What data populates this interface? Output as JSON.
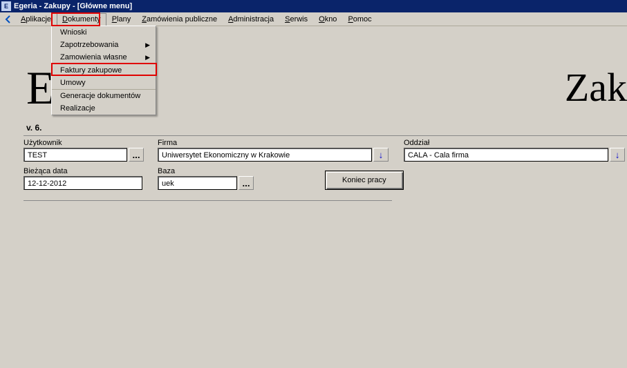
{
  "window": {
    "title": "Egeria - Zakupy - [Główne menu]"
  },
  "menubar": {
    "items": [
      {
        "label": "Aplikacje",
        "u": "A"
      },
      {
        "label": "Dokumenty",
        "u": "D"
      },
      {
        "label": "Plany",
        "u": "P"
      },
      {
        "label": "Zamówienia publiczne",
        "u": "Z"
      },
      {
        "label": "Administracja",
        "u": "A"
      },
      {
        "label": "Serwis",
        "u": "S"
      },
      {
        "label": "Okno",
        "u": "O"
      },
      {
        "label": "Pomoc",
        "u": "P"
      }
    ]
  },
  "dropdown": {
    "items": [
      {
        "label": "Wnioski",
        "submenu": false,
        "u": "W"
      },
      {
        "label": "Zapotrzebowania",
        "submenu": true,
        "u": "Z"
      },
      {
        "label": "Zamowienia własne",
        "submenu": true,
        "u": "a",
        "sep": true
      },
      {
        "label": "Faktury zakupowe",
        "submenu": false,
        "u": "F"
      },
      {
        "label": "Umowy",
        "submenu": false,
        "u": "U",
        "sep": true
      },
      {
        "label": "Generacje dokumentów",
        "submenu": false,
        "u": "G"
      },
      {
        "label": "Realizacje",
        "submenu": false,
        "u": "R"
      }
    ]
  },
  "page": {
    "title_left_fragment": "E",
    "title_right_fragment": "Zak",
    "version": "v. 6."
  },
  "form": {
    "user_label": "Użytkownik",
    "user_value": "TEST",
    "firm_label": "Firma",
    "firm_value": "Uniwersytet Ekonomiczny w Krakowie",
    "branch_label": "Oddział",
    "branch_value": "CALA - Cala firma",
    "date_label": "Bieżąca data",
    "date_value": "12-12-2012",
    "db_label": "Baza",
    "db_value": "uek",
    "end_button": "Koniec pracy",
    "ellipsis": "...",
    "save_glyph": "↓"
  }
}
